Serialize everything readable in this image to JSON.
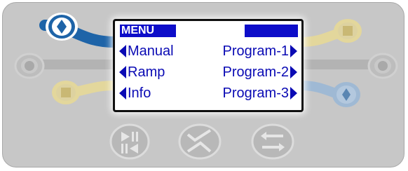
{
  "screen": {
    "menu_title": "MENU",
    "left_items": [
      "Manual",
      "Ramp",
      "Info"
    ],
    "right_items": [
      "Program-1",
      "Program-2",
      "Program-3"
    ]
  },
  "icons": {
    "top_left_key": "diamond-icon",
    "mid_left_key": "circle-icon",
    "bottom_left_key": "square-icon",
    "top_right_key": "square-icon",
    "mid_right_key": "circle-icon",
    "bottom_right_key": "diamond-icon",
    "play_pause_key": "play-pause-icon",
    "confirm_key": "check-icon",
    "swap_key": "swap-arrows-icon"
  },
  "colors": {
    "panel": "#c7c7c7",
    "highlight_blue": "#1e64a8",
    "blue_trace": "#9fb9d4",
    "yellow_trace": "#e3d79c",
    "gray_trace": "#b3b3b3",
    "lcd_text": "#0a0ab4",
    "lcd_title_bg": "#0d0dc9"
  }
}
